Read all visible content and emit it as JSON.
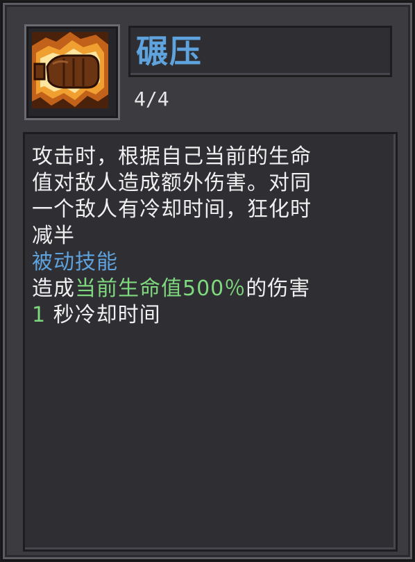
{
  "skill": {
    "name": "碾压",
    "level": "4/4",
    "icon": "crushing-fist-icon",
    "description_lines": [
      "攻击时，根据自己当前的生命",
      "值对敌人造成额外伤害。对同",
      "一个敌人有冷却时间，狂化时",
      "减半"
    ],
    "type_label": "被动技能",
    "effect": {
      "prefix": "造成",
      "highlight": "当前生命值500％",
      "suffix": "的伤害"
    },
    "cooldown": {
      "value": "1",
      "label": " 秒冷却时间"
    }
  },
  "colors": {
    "title": "#5fa3de",
    "highlight": "#7fd97f",
    "text": "#f0f0f0",
    "panel": "#3b3b40"
  }
}
